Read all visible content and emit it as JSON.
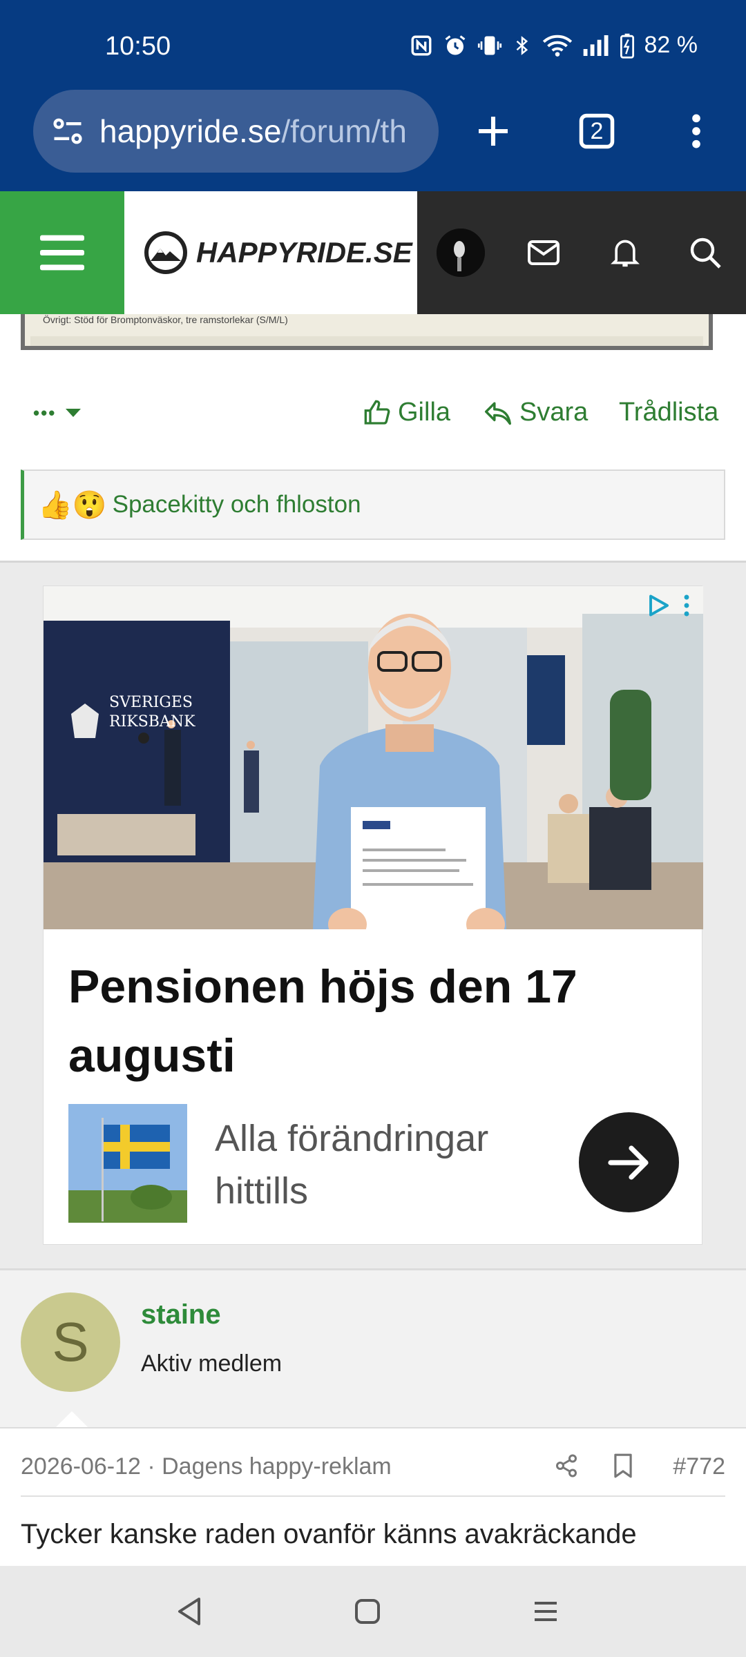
{
  "status_bar": {
    "time": "10:50",
    "battery": "82 %",
    "icons": [
      "nfc-icon",
      "alarm-icon",
      "vibrate-icon",
      "bluetooth-icon",
      "wifi-icon",
      "signal-icon",
      "battery-icon"
    ]
  },
  "browser": {
    "url_domain": "happyride.se",
    "url_path": "/forum/th",
    "tab_count": "2"
  },
  "site": {
    "logo_text": "HAPPYRIDE.SE",
    "colors": {
      "green": "#37a545",
      "dark": "#2b2b2b",
      "chrome_blue": "#063b82"
    }
  },
  "embedded_doc": {
    "text": "Övrigt: Stöd för Bromptonväskor, tre ramstorlekar (S/M/L)"
  },
  "post_actions": {
    "more": "•••",
    "like": "Gilla",
    "reply": "Svara",
    "thread_list": "Trådlista"
  },
  "reactions": {
    "emojis": [
      "👍",
      "😲"
    ],
    "text": "Spacekitty och fhloston"
  },
  "ad": {
    "image_sign_line1": "SVERIGES",
    "image_sign_line2": "RIKSBANK",
    "headline": "Pensionen höjs den 17 augusti",
    "subtext": "Alla förändringar hittills"
  },
  "user": {
    "initial": "S",
    "name": "staine",
    "title": "Aktiv medlem"
  },
  "post": {
    "meta": "2026-06-12 · Dagens happy-reklam",
    "number": "#772",
    "body": "Tycker kanske raden ovanför känns avakräckande"
  }
}
